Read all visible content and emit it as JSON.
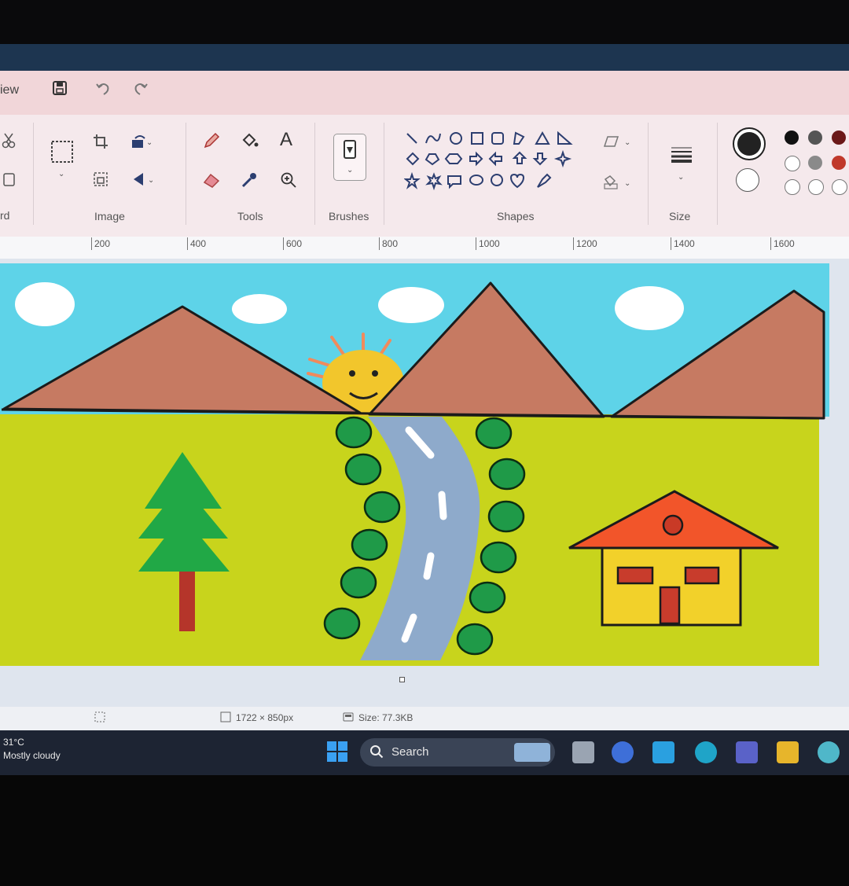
{
  "app": {
    "menu_partial": "iew",
    "clipboard_partial": "rd"
  },
  "ribbon": {
    "groups": {
      "image": "Image",
      "tools": "Tools",
      "brushes": "Brushes",
      "shapes": "Shapes",
      "size": "Size"
    }
  },
  "ruler": {
    "ticks": [
      "200",
      "400",
      "600",
      "800",
      "1000",
      "1200",
      "1400",
      "1600"
    ]
  },
  "colors": {
    "primary": "#222222",
    "secondary": "#ffffff",
    "palette_row1": [
      "#111111",
      "#555555",
      "#6b1818"
    ],
    "palette_row2": [
      "#ffffff",
      "#8a8a8a",
      "#c0392b"
    ],
    "palette_row3": [
      "#ffffff",
      "#ffffff",
      "#ffffff"
    ]
  },
  "status": {
    "dimensions": "1722 × 850px",
    "size": "Size: 77.3KB"
  },
  "taskbar": {
    "weather_temp": "31°C",
    "weather_desc": "Mostly cloudy",
    "search_label": "Search"
  }
}
